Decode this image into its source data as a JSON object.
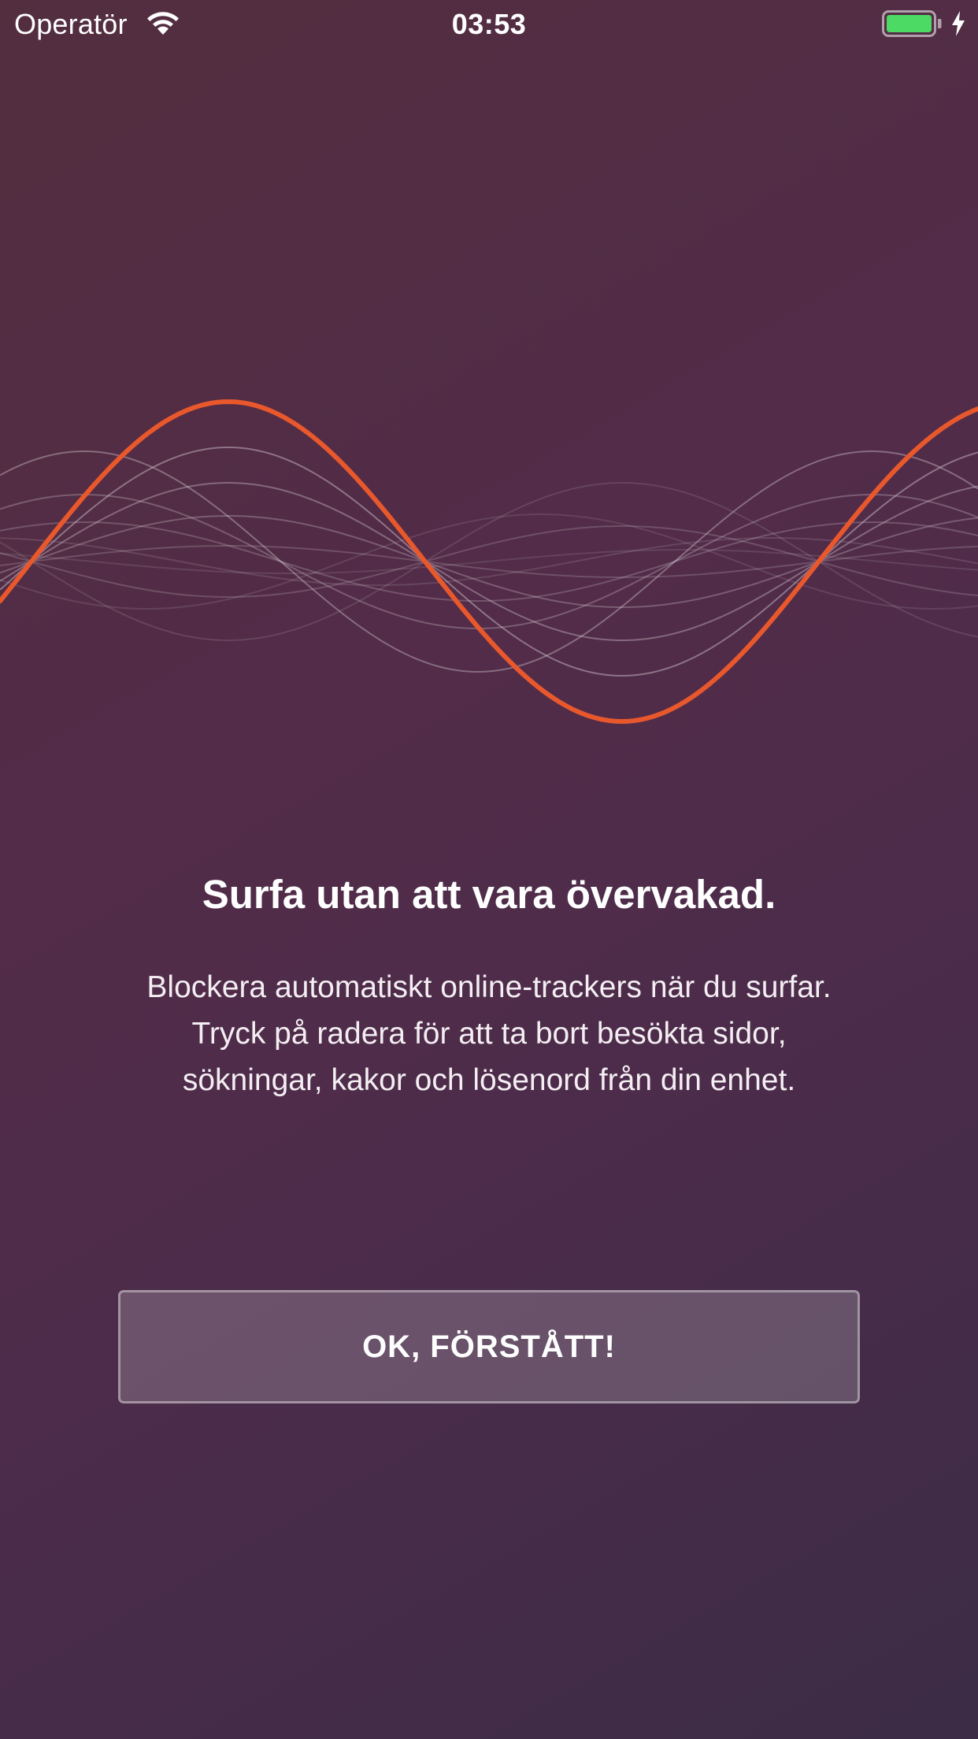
{
  "status_bar": {
    "carrier": "Operatör",
    "time": "03:53",
    "wifi_icon": "wifi-icon",
    "battery_icon": "battery-charging-icon",
    "battery_color": "#4cd964"
  },
  "onboarding": {
    "illustration": "sine-wave-illustration",
    "accent_color": "#e8582c",
    "title": "Surfa utan att vara övervakad.",
    "description": "Blockera automatiskt online-trackers när du surfar. Tryck på radera för att ta bort besökta sidor, sökningar, kakor och lösenord från din enhet.",
    "button_label": "OK, FÖRSTÅTT!"
  },
  "colors": {
    "background_top": "#532e3f",
    "background_bottom": "#3c2c46"
  }
}
